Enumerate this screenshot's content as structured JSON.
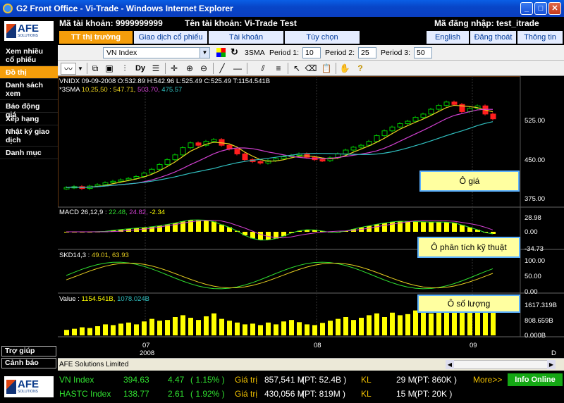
{
  "window": {
    "title": "G2 Front Office - Vi-Trade - Windows Internet Explorer",
    "min": "_",
    "max": "□",
    "close": "✕"
  },
  "header": {
    "account_label": "Mã tài khoản: 9999999999",
    "account_name": "Tên tài khoản: Vi-Trade Test",
    "login": "Mã đăng nhập: test_itrade",
    "logo_text": "AFE",
    "logo_sub": "SOLUTIONS",
    "tabs": [
      "TT thị trường",
      "Giao dịch cổ phiếu",
      "Tài khoản",
      "Tùy chọn"
    ],
    "right_tabs": [
      "English",
      "Đăng thoát",
      "Thông tin"
    ]
  },
  "nav": {
    "items": [
      "Xem nhiều cổ phiếu",
      "Đồ thị",
      "Danh sách xem",
      "Báo động giá",
      "Xếp hạng",
      "Nhật ký giao dịch",
      "Danh mục"
    ],
    "help": "Trợ giúp",
    "alert": "Cảnh báo"
  },
  "toolbar": {
    "symbol": "VN Index",
    "indicator": "3SMA",
    "p1_label": "Period 1:",
    "p1": "10",
    "p2_label": "Period 2:",
    "p2": "25",
    "p3_label": "Period 3:",
    "p3": "50"
  },
  "chart": {
    "ohlc_text": "VNIDX 09-09-2008 O:532.89 H:542.96 L:525.49 C:525.49 T:1154.541B",
    "sma_label": "*3SMA",
    "sma_params": "10,25,50 : ",
    "sma_v1": "547.71,",
    "sma_v2": "503.70,",
    "sma_v3": "475.57",
    "macd_label": "MACD 26,12,9 : ",
    "macd_v1": "22.48,",
    "macd_v2": "24.82,",
    "macd_v3": "-2.34",
    "skd_label": "SKD14,3 : ",
    "skd_v": "49.01, 63.93",
    "vol_label": "Value : ",
    "vol_v1": "1154.541B,",
    "vol_v2": "1078.024B",
    "price_ticks": [
      "525.00",
      "450.00",
      "375.00"
    ],
    "macd_ticks": [
      "28.98",
      "0.00",
      "-34.73"
    ],
    "skd_ticks": [
      "100.00",
      "50.00",
      "0.00"
    ],
    "vol_ticks": [
      "1617.319B",
      "808.659B",
      "0.000B"
    ],
    "x_ticks": [
      "07",
      "08",
      "09"
    ],
    "x_year": "2008",
    "x_corner": "D",
    "callout_price": "Ô giá",
    "callout_tech": "Ô phân tích kỹ thuật",
    "callout_vol": "Ô số lượng",
    "colors": {
      "sma1": "#e8d020",
      "sma2": "#d040d0",
      "sma3": "#30c0c0",
      "up": "#00c800",
      "down": "#ff1e1e",
      "volume": "#ffff00"
    }
  },
  "chart_data": {
    "type": "candlestick",
    "title": "VNIDX",
    "y_range": [
      350,
      570
    ],
    "x": [
      "07",
      "08",
      "09"
    ],
    "closes": [
      382,
      384,
      380,
      385,
      388,
      392,
      395,
      398,
      401,
      405,
      412,
      420,
      430,
      440,
      450,
      465,
      475,
      470,
      478,
      482,
      470,
      462,
      452,
      440,
      436,
      433,
      438,
      442,
      446,
      449,
      452,
      445,
      440,
      438,
      444,
      452,
      460,
      466,
      470,
      478,
      490,
      500,
      508,
      515,
      520,
      528,
      535,
      545,
      553,
      560,
      555,
      540,
      547,
      552,
      535,
      525
    ],
    "volume": [
      0.15,
      0.18,
      0.22,
      0.2,
      0.25,
      0.3,
      0.28,
      0.32,
      0.35,
      0.3,
      0.38,
      0.45,
      0.4,
      0.42,
      0.5,
      0.55,
      0.48,
      0.42,
      0.52,
      0.6,
      0.45,
      0.4,
      0.35,
      0.3,
      0.32,
      0.28,
      0.35,
      0.3,
      0.38,
      0.42,
      0.36,
      0.3,
      0.28,
      0.34,
      0.4,
      0.45,
      0.5,
      0.42,
      0.48,
      0.55,
      0.6,
      0.5,
      0.62,
      0.55,
      0.58,
      0.68,
      0.72,
      0.6,
      0.75,
      0.82,
      0.7,
      0.78,
      0.65,
      0.72,
      0.7,
      0.71
    ]
  },
  "status": {
    "text": "AFE Solutions Limited"
  },
  "ticker": {
    "r1": {
      "name": "VN Index",
      "val": "394.63",
      "chg": "4.47",
      "pct": "( 1.15% )",
      "gt": "Giá trị",
      "gtv": "857,541 M",
      "pt": "(PT:   52.4B )",
      "kl": "KL",
      "klv": "29 M",
      "pt2": "(PT:      860K )",
      "more": "More>>"
    },
    "r2": {
      "name": "HASTC Index",
      "val": "138.77",
      "chg": "2.61",
      "pct": "( 1.92% )",
      "gt": "Giá trị",
      "gtv": "430,056 M",
      "pt": "(PT:   819M )",
      "kl": "KL",
      "klv": "15 M",
      "pt2": "(PT:        20K )"
    },
    "info": "Info Online"
  }
}
